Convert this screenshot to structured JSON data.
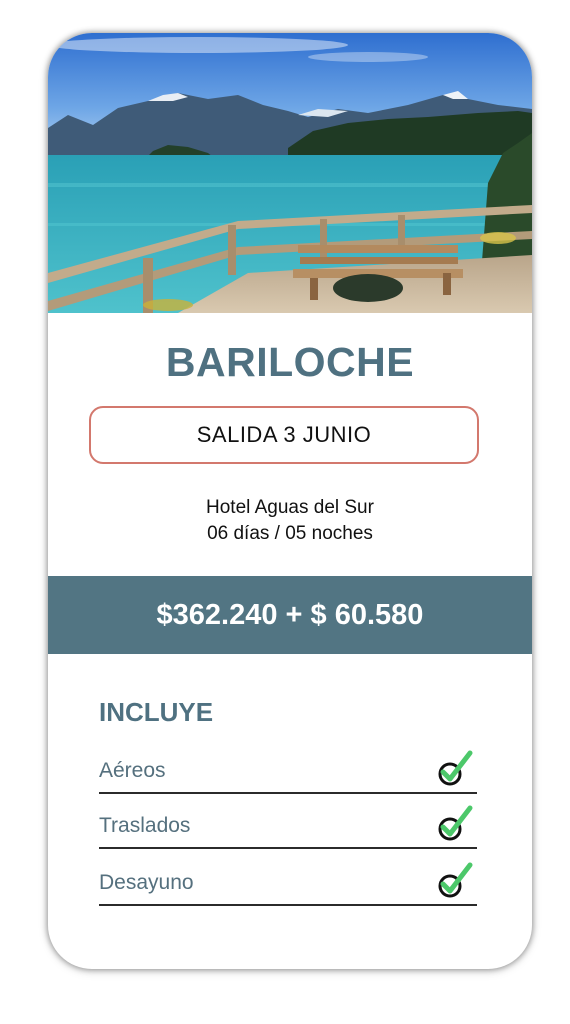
{
  "destination": {
    "title": "BARILOCHE",
    "departure": "SALIDA 3 JUNIO",
    "hotel": "Hotel Aguas del Sur",
    "duration": "06 días / 05 noches",
    "price": "$362.240 + $ 60.580"
  },
  "includes": {
    "heading": "INCLUYE",
    "items": [
      {
        "label": "Aéreos",
        "icon": "check-icon"
      },
      {
        "label": "Traslados",
        "icon": "check-icon"
      },
      {
        "label": "Desayuno",
        "icon": "check-icon"
      }
    ]
  },
  "colors": {
    "accent": "#4f7181",
    "price_band": "#527583",
    "badge_border": "#d3786d",
    "check_green": "#4cc86a"
  }
}
